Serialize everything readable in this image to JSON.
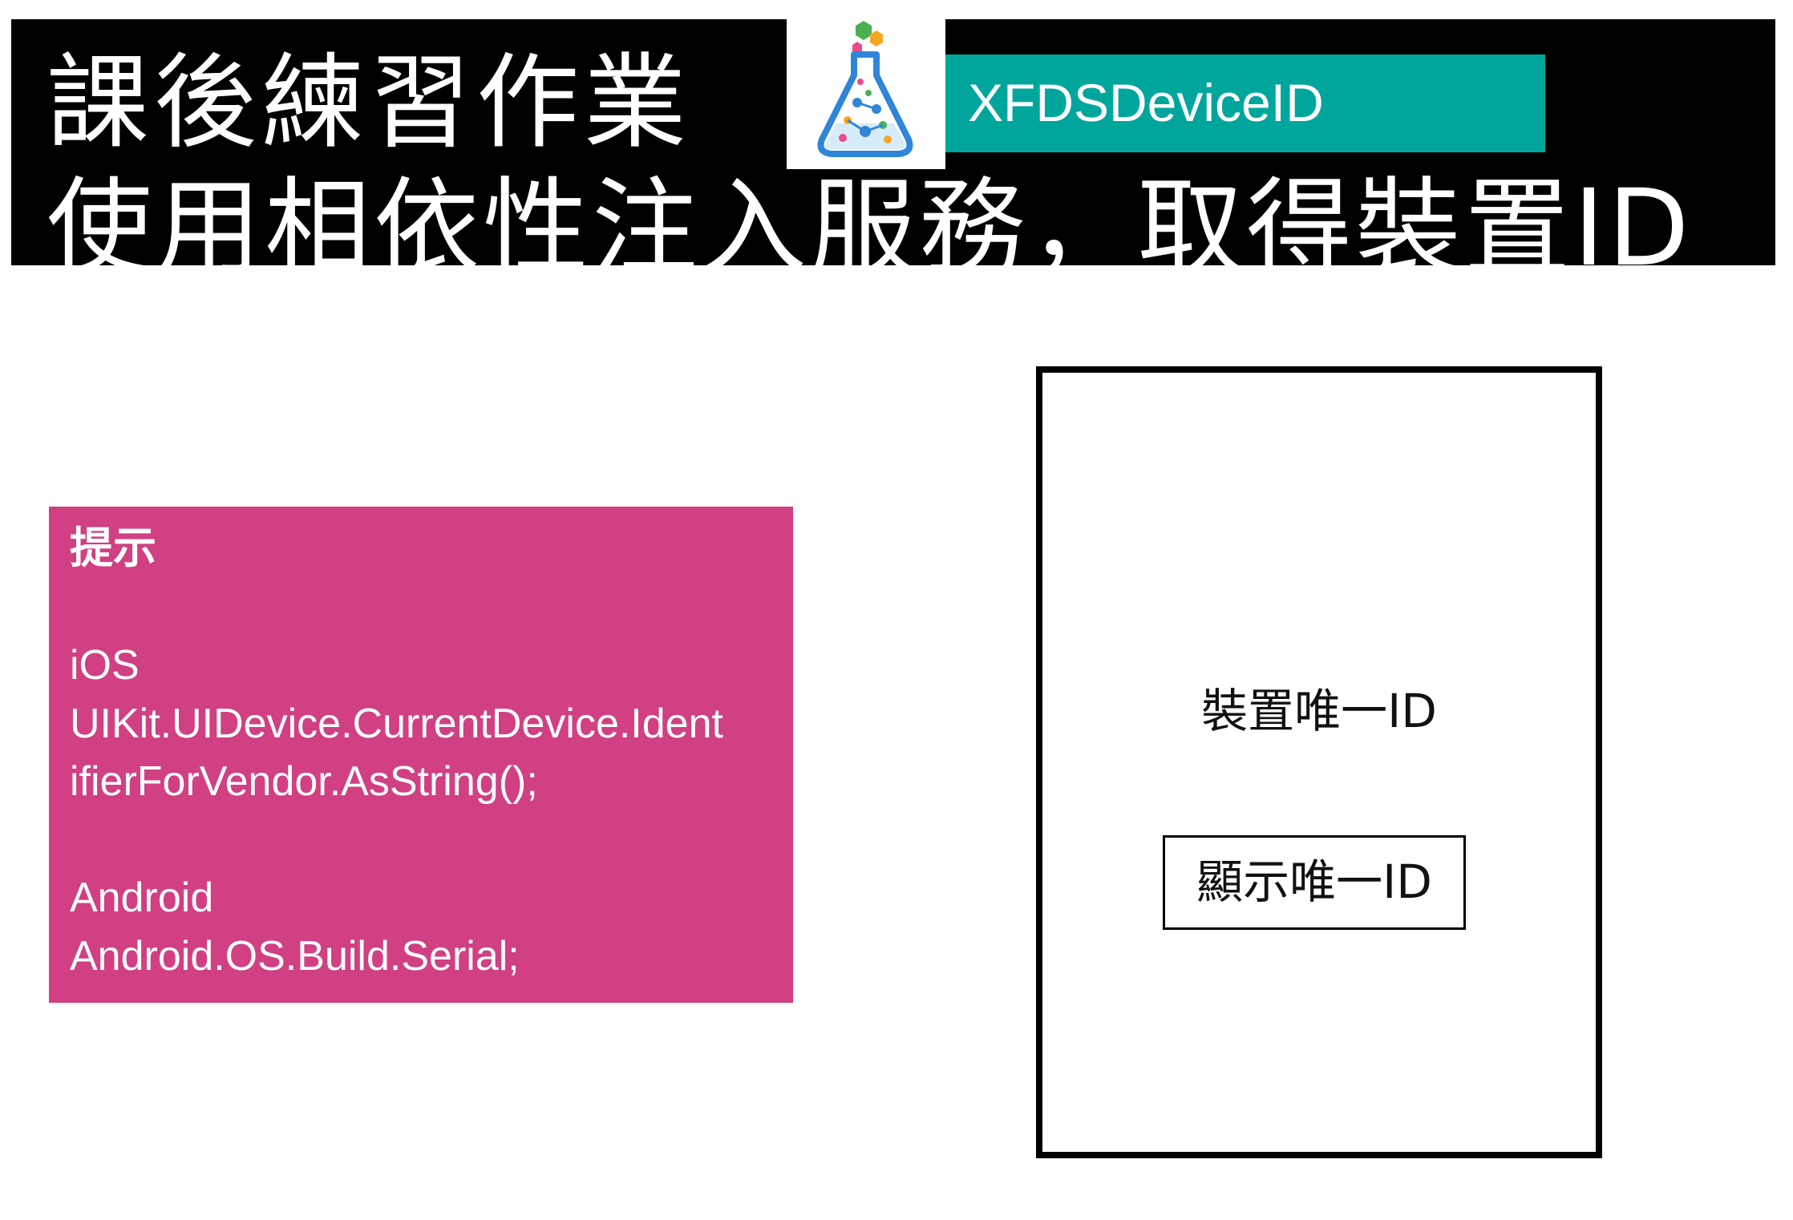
{
  "header": {
    "title_line1": "課後練習作業",
    "title_line2": "使用相依性注入服務，取得裝置ID",
    "project_name": "XFDSDeviceID",
    "logo_icon": "flask-icon"
  },
  "hint": {
    "title": "提示",
    "ios_label": "iOS",
    "ios_code_line1": "UIKit.UIDevice.CurrentDevice.Ident",
    "ios_code_line2": "ifierForVendor.AsString();",
    "android_label": "Android",
    "android_code": "Android.OS.Build.Serial;"
  },
  "phone": {
    "device_id_label": "裝置唯一ID",
    "show_id_button": "顯示唯一ID"
  },
  "colors": {
    "header_bg": "#000000",
    "project_banner": "#00a69c",
    "hint_bg": "#d04082"
  }
}
